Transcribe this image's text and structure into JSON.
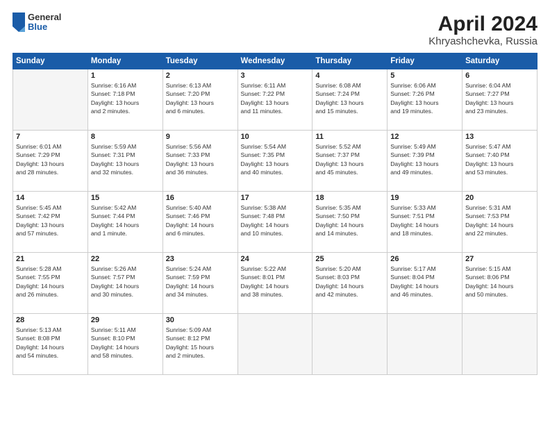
{
  "logo": {
    "general": "General",
    "blue": "Blue"
  },
  "title": "April 2024",
  "subtitle": "Khryashchevka, Russia",
  "weekdays": [
    "Sunday",
    "Monday",
    "Tuesday",
    "Wednesday",
    "Thursday",
    "Friday",
    "Saturday"
  ],
  "weeks": [
    [
      {
        "day": "",
        "info": ""
      },
      {
        "day": "1",
        "info": "Sunrise: 6:16 AM\nSunset: 7:18 PM\nDaylight: 13 hours\nand 2 minutes."
      },
      {
        "day": "2",
        "info": "Sunrise: 6:13 AM\nSunset: 7:20 PM\nDaylight: 13 hours\nand 6 minutes."
      },
      {
        "day": "3",
        "info": "Sunrise: 6:11 AM\nSunset: 7:22 PM\nDaylight: 13 hours\nand 11 minutes."
      },
      {
        "day": "4",
        "info": "Sunrise: 6:08 AM\nSunset: 7:24 PM\nDaylight: 13 hours\nand 15 minutes."
      },
      {
        "day": "5",
        "info": "Sunrise: 6:06 AM\nSunset: 7:26 PM\nDaylight: 13 hours\nand 19 minutes."
      },
      {
        "day": "6",
        "info": "Sunrise: 6:04 AM\nSunset: 7:27 PM\nDaylight: 13 hours\nand 23 minutes."
      }
    ],
    [
      {
        "day": "7",
        "info": "Sunrise: 6:01 AM\nSunset: 7:29 PM\nDaylight: 13 hours\nand 28 minutes."
      },
      {
        "day": "8",
        "info": "Sunrise: 5:59 AM\nSunset: 7:31 PM\nDaylight: 13 hours\nand 32 minutes."
      },
      {
        "day": "9",
        "info": "Sunrise: 5:56 AM\nSunset: 7:33 PM\nDaylight: 13 hours\nand 36 minutes."
      },
      {
        "day": "10",
        "info": "Sunrise: 5:54 AM\nSunset: 7:35 PM\nDaylight: 13 hours\nand 40 minutes."
      },
      {
        "day": "11",
        "info": "Sunrise: 5:52 AM\nSunset: 7:37 PM\nDaylight: 13 hours\nand 45 minutes."
      },
      {
        "day": "12",
        "info": "Sunrise: 5:49 AM\nSunset: 7:39 PM\nDaylight: 13 hours\nand 49 minutes."
      },
      {
        "day": "13",
        "info": "Sunrise: 5:47 AM\nSunset: 7:40 PM\nDaylight: 13 hours\nand 53 minutes."
      }
    ],
    [
      {
        "day": "14",
        "info": "Sunrise: 5:45 AM\nSunset: 7:42 PM\nDaylight: 13 hours\nand 57 minutes."
      },
      {
        "day": "15",
        "info": "Sunrise: 5:42 AM\nSunset: 7:44 PM\nDaylight: 14 hours\nand 1 minute."
      },
      {
        "day": "16",
        "info": "Sunrise: 5:40 AM\nSunset: 7:46 PM\nDaylight: 14 hours\nand 6 minutes."
      },
      {
        "day": "17",
        "info": "Sunrise: 5:38 AM\nSunset: 7:48 PM\nDaylight: 14 hours\nand 10 minutes."
      },
      {
        "day": "18",
        "info": "Sunrise: 5:35 AM\nSunset: 7:50 PM\nDaylight: 14 hours\nand 14 minutes."
      },
      {
        "day": "19",
        "info": "Sunrise: 5:33 AM\nSunset: 7:51 PM\nDaylight: 14 hours\nand 18 minutes."
      },
      {
        "day": "20",
        "info": "Sunrise: 5:31 AM\nSunset: 7:53 PM\nDaylight: 14 hours\nand 22 minutes."
      }
    ],
    [
      {
        "day": "21",
        "info": "Sunrise: 5:28 AM\nSunset: 7:55 PM\nDaylight: 14 hours\nand 26 minutes."
      },
      {
        "day": "22",
        "info": "Sunrise: 5:26 AM\nSunset: 7:57 PM\nDaylight: 14 hours\nand 30 minutes."
      },
      {
        "day": "23",
        "info": "Sunrise: 5:24 AM\nSunset: 7:59 PM\nDaylight: 14 hours\nand 34 minutes."
      },
      {
        "day": "24",
        "info": "Sunrise: 5:22 AM\nSunset: 8:01 PM\nDaylight: 14 hours\nand 38 minutes."
      },
      {
        "day": "25",
        "info": "Sunrise: 5:20 AM\nSunset: 8:03 PM\nDaylight: 14 hours\nand 42 minutes."
      },
      {
        "day": "26",
        "info": "Sunrise: 5:17 AM\nSunset: 8:04 PM\nDaylight: 14 hours\nand 46 minutes."
      },
      {
        "day": "27",
        "info": "Sunrise: 5:15 AM\nSunset: 8:06 PM\nDaylight: 14 hours\nand 50 minutes."
      }
    ],
    [
      {
        "day": "28",
        "info": "Sunrise: 5:13 AM\nSunset: 8:08 PM\nDaylight: 14 hours\nand 54 minutes."
      },
      {
        "day": "29",
        "info": "Sunrise: 5:11 AM\nSunset: 8:10 PM\nDaylight: 14 hours\nand 58 minutes."
      },
      {
        "day": "30",
        "info": "Sunrise: 5:09 AM\nSunset: 8:12 PM\nDaylight: 15 hours\nand 2 minutes."
      },
      {
        "day": "",
        "info": ""
      },
      {
        "day": "",
        "info": ""
      },
      {
        "day": "",
        "info": ""
      },
      {
        "day": "",
        "info": ""
      }
    ]
  ]
}
